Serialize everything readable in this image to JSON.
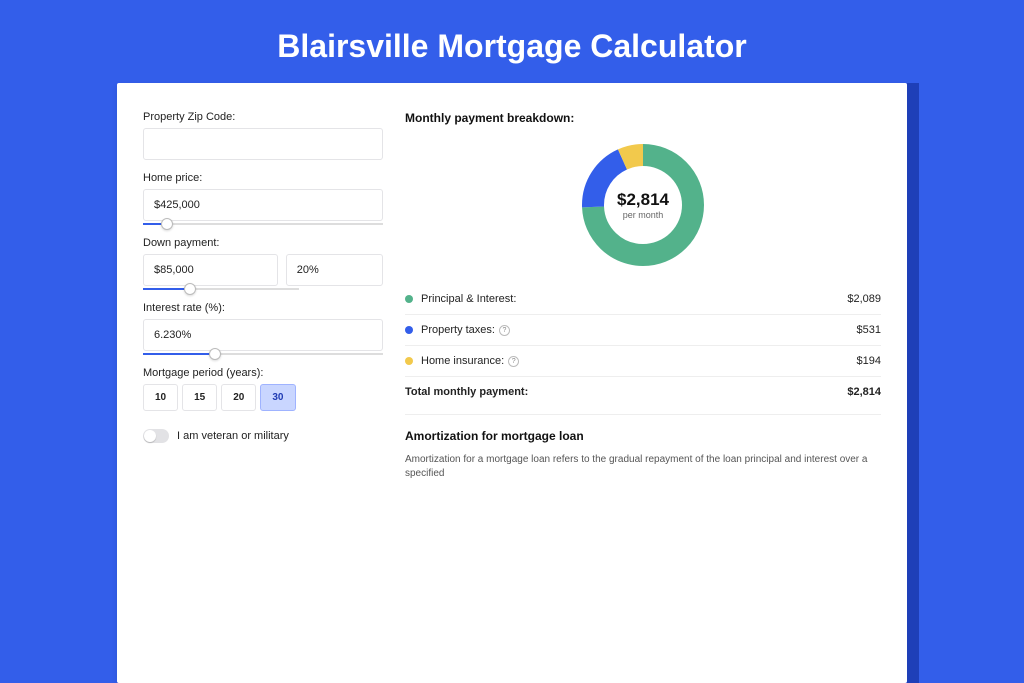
{
  "title": "Blairsville Mortgage Calculator",
  "form": {
    "zip_label": "Property Zip Code:",
    "zip_value": "",
    "price_label": "Home price:",
    "price_value": "$425,000",
    "price_slider_pct": 10,
    "down_label": "Down payment:",
    "down_value": "$85,000",
    "down_pct_value": "20%",
    "down_slider_pct": 20,
    "rate_label": "Interest rate (%):",
    "rate_value": "6.230%",
    "rate_slider_pct": 30,
    "period_label": "Mortgage period (years):",
    "periods": [
      "10",
      "15",
      "20",
      "30"
    ],
    "period_active_index": 3,
    "veteran_label": "I am veteran or military"
  },
  "breakdown": {
    "title": "Monthly payment breakdown:",
    "donut_value": "$2,814",
    "donut_sub": "per month",
    "items": [
      {
        "label": "Principal & Interest:",
        "value": "$2,089",
        "color": "#53b28b",
        "info": false
      },
      {
        "label": "Property taxes:",
        "value": "$531",
        "color": "#335eea",
        "info": true
      },
      {
        "label": "Home insurance:",
        "value": "$194",
        "color": "#f2c94c",
        "info": true
      }
    ],
    "total_label": "Total monthly payment:",
    "total_value": "$2,814"
  },
  "amort": {
    "title": "Amortization for mortgage loan",
    "text": "Amortization for a mortgage loan refers to the gradual repayment of the loan principal and interest over a specified"
  },
  "chart_data": {
    "type": "pie",
    "title": "Monthly payment breakdown",
    "series": [
      {
        "name": "Principal & Interest",
        "value": 2089,
        "color": "#53b28b"
      },
      {
        "name": "Property taxes",
        "value": 531,
        "color": "#335eea"
      },
      {
        "name": "Home insurance",
        "value": 194,
        "color": "#f2c94c"
      }
    ],
    "total": 2814
  }
}
